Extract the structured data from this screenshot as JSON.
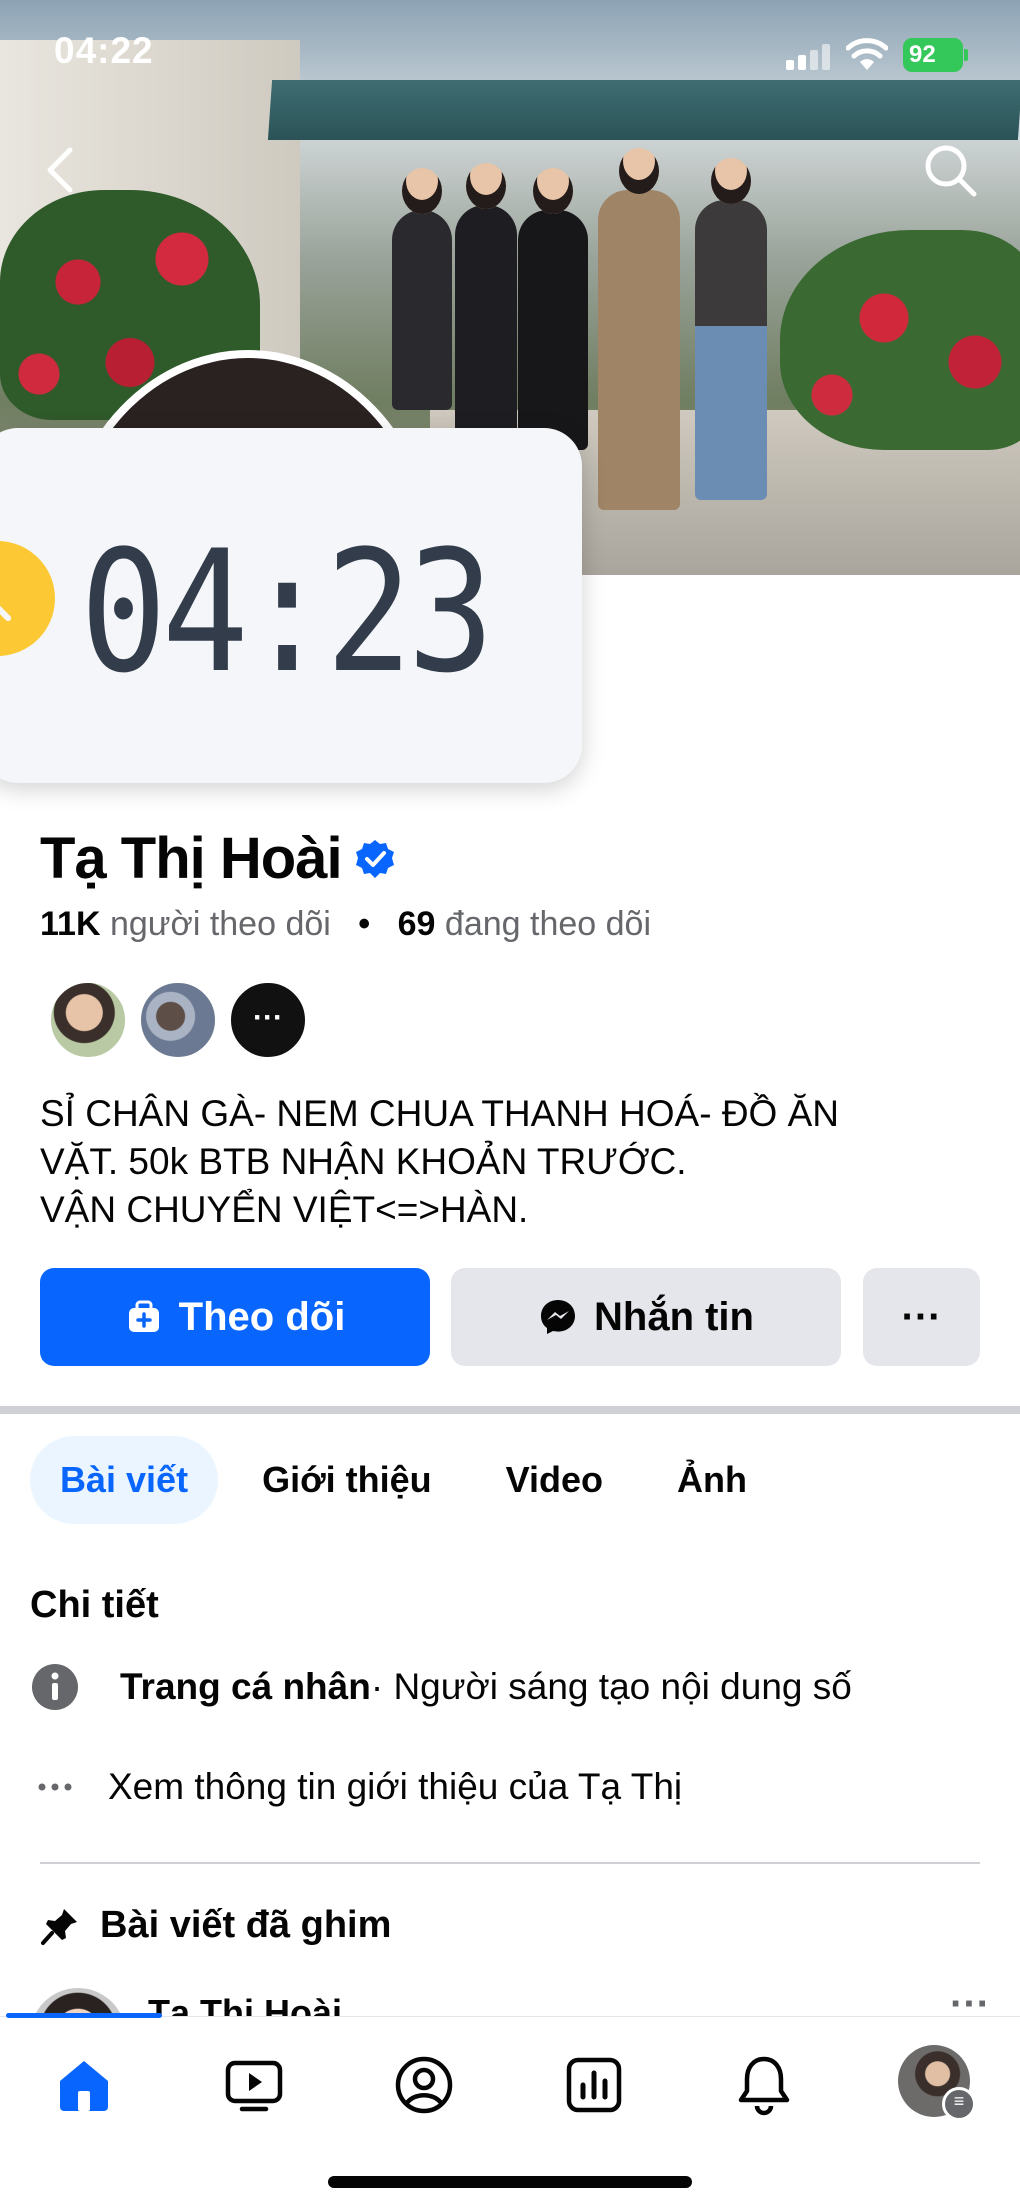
{
  "status_bar": {
    "time": "04:22",
    "battery": "92"
  },
  "overlay_clock": {
    "time": "04:23"
  },
  "profile": {
    "name": "Tạ Thị Hoài",
    "followers_count": "11K",
    "followers_label": "người theo dõi",
    "following_count": "69",
    "following_label": "đang theo dõi",
    "mutuals_more": "···",
    "bio_lines": [
      "SỈ CHÂN GÀ- NEM CHUA THANH HOÁ- ĐỒ ĂN",
      "VẶT. 50k BTB NHẬN KHOẢN TRƯỚC.",
      "VẬN CHUYỂN VIỆT<=>HÀN."
    ]
  },
  "actions": {
    "follow_label": "Theo dõi",
    "message_label": "Nhắn tin",
    "more_label": "···"
  },
  "tabs": [
    {
      "label": "Bài viết",
      "active": true
    },
    {
      "label": "Giới thiệu",
      "active": false
    },
    {
      "label": "Video",
      "active": false
    },
    {
      "label": "Ảnh",
      "active": false
    }
  ],
  "details": {
    "title": "Chi tiết",
    "profile_type_bold": "Trang cá nhân",
    "profile_type_rest": " · Người sáng tạo nội dung số",
    "see_more": "Xem thông tin giới thiệu của Tạ Thị"
  },
  "pinned": {
    "title": "Bài viết đã ghim",
    "author": "Tạ Thị Hoài",
    "more": "···"
  },
  "colors": {
    "accent": "#0866ff",
    "button_gray": "#e4e6eb",
    "text_secondary": "#65676b",
    "clock_yellow": "#fcc934"
  },
  "icons": {
    "back": "chevron-left-icon",
    "search": "search-icon",
    "verified": "verified-badge-icon",
    "follow": "add-person-icon",
    "messenger": "messenger-icon",
    "info": "info-icon",
    "more": "ellipsis-icon",
    "pin": "pin-icon",
    "home": "home-icon",
    "video": "video-icon",
    "profile": "profile-icon",
    "dashboard": "dashboard-icon",
    "notifications": "bell-icon"
  }
}
